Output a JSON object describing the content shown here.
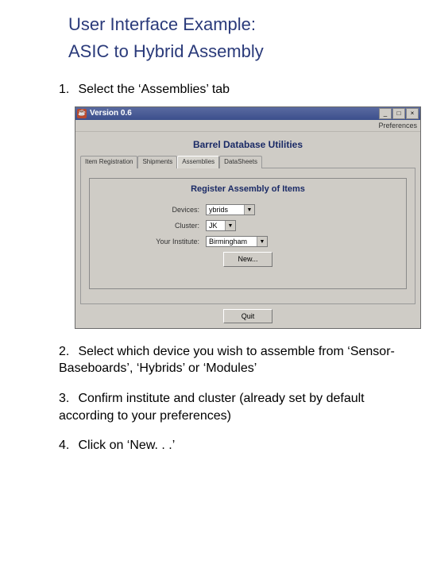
{
  "title": "User Interface Example:",
  "subtitle": "ASIC to Hybrid Assembly",
  "steps": {
    "s1": {
      "num": "1.",
      "text": "Select the ‘Assemblies’ tab"
    },
    "s2": {
      "num": "2.",
      "text": "Select which device you wish to assemble from ‘Sensor-Baseboards’, ‘Hybrids’ or ‘Modules’"
    },
    "s3": {
      "num": "3.",
      "text": "Confirm institute and cluster (already set by default according to your preferences)"
    },
    "s4": {
      "num": "4.",
      "text": "Click on ‘New. . .’"
    }
  },
  "app": {
    "window_title": "Version 0.6",
    "menu_preferences": "Preferences",
    "main_title": "Barrel Database Utilities",
    "tabs": {
      "t1": "Item Registration",
      "t2": "Shipments",
      "t3": "Assemblies",
      "t4": "DataSheets"
    },
    "group_title": "Register Assembly of Items",
    "fields": {
      "devices_label": "Devices:",
      "devices_value": "ybrids",
      "cluster_label": "Cluster:",
      "cluster_value": "JK",
      "institute_label": "Your Institute:",
      "institute_value": "Birmingham"
    },
    "buttons": {
      "new": "New...",
      "quit": "Quit"
    },
    "winbtns": {
      "min": "_",
      "max": "□",
      "close": "×"
    }
  }
}
